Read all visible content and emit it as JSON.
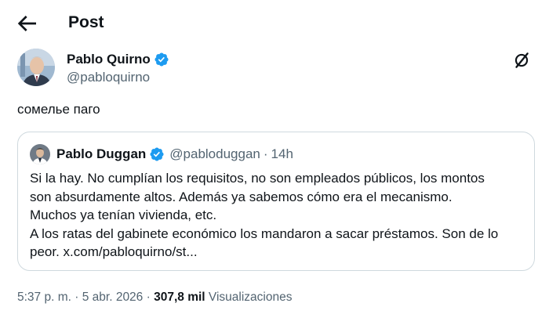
{
  "header": {
    "title": "Post",
    "back_icon": "arrow-left-icon"
  },
  "author": {
    "name": "Pablo Quirno",
    "handle": "@pabloquirno",
    "verified_icon": "verified-badge-icon",
    "menu_icon": "grok-icon"
  },
  "tweet": {
    "text": "сомелье паго"
  },
  "quote": {
    "name": "Pablo Duggan",
    "handle": "@pabloduggan",
    "separator": "·",
    "time": "14h",
    "lines": [
      "Si la hay. No cumplían los requisitos, no son empleados públicos, los montos",
      "son absurdamente altos. Además ya sabemos cómo era el mecanismo.",
      "Muchos ya tenían vivienda, etc.",
      "A los ratas del gabinete económico los mandaron a sacar préstamos. Son de lo",
      "peor. x.com/pabloquirno/st..."
    ]
  },
  "meta": {
    "time": "5:37 p. m.",
    "separator": "·",
    "date": "5 abr. 2026",
    "separator2": "·",
    "views_count": "307,8 mil",
    "views_label": "Visualizaciones"
  },
  "colors": {
    "text": "#0f1419",
    "secondary": "#536471",
    "border": "#cfd9de",
    "verified": "#1d9bf0"
  }
}
